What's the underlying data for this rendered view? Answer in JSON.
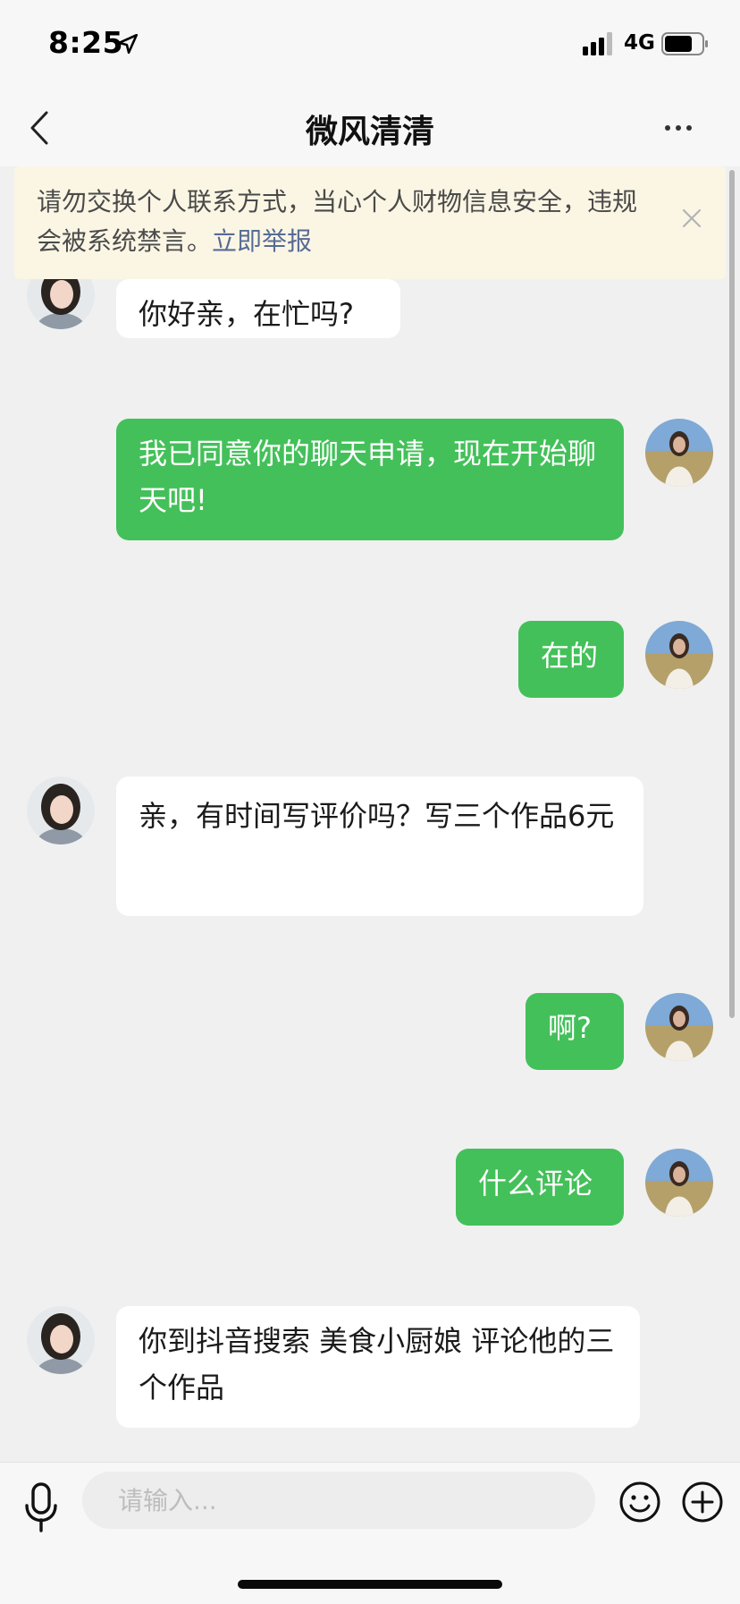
{
  "status_bar": {
    "time": "8:25",
    "network": "4G"
  },
  "header": {
    "title": "微风清清"
  },
  "warning": {
    "text": "请勿交换个人联系方式，当心个人财物信息安全，违规会被系统禁言。",
    "link": "立即举报"
  },
  "messages": [
    {
      "side": "in",
      "text": "你好亲，在忙吗?"
    },
    {
      "side": "out",
      "text": "我已同意你的聊天申请，现在开始聊天吧!"
    },
    {
      "side": "out",
      "text": "在的"
    },
    {
      "side": "in",
      "text": "亲，有时间写评价吗？写三个作品6元"
    },
    {
      "side": "out",
      "text": "啊?"
    },
    {
      "side": "out",
      "text": "什么评论"
    },
    {
      "side": "in",
      "text": "你到抖音搜索 美食小厨娘 评论他的三个作品"
    }
  ],
  "input": {
    "placeholder": "请输入..."
  },
  "colors": {
    "outgoing_bubble": "#44c05a",
    "incoming_bubble": "#ffffff",
    "background": "#f0f0f0",
    "link": "#576b95"
  },
  "icons": [
    "location-arrow-icon",
    "signal-icon",
    "battery-icon",
    "back-chevron-icon",
    "more-dots-icon",
    "close-icon",
    "microphone-icon",
    "emoji-icon",
    "plus-icon"
  ]
}
